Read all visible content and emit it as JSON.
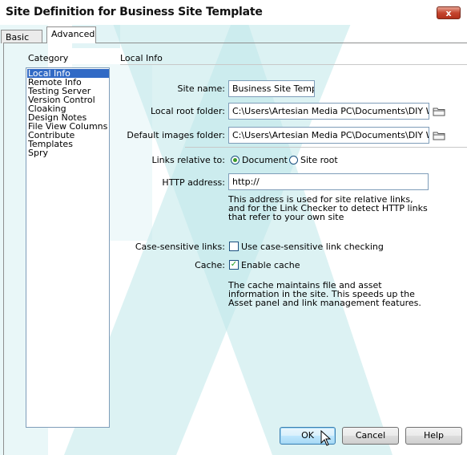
{
  "window": {
    "title": "Site Definition for Business Site Template",
    "close_label": "x"
  },
  "tabs": [
    {
      "label": "Basic"
    },
    {
      "label": "Advanced"
    }
  ],
  "category": {
    "heading": "Category",
    "items": [
      {
        "label": "Local Info",
        "selected": true
      },
      {
        "label": "Remote Info"
      },
      {
        "label": "Testing Server"
      },
      {
        "label": "Version Control"
      },
      {
        "label": "Cloaking"
      },
      {
        "label": "Design Notes"
      },
      {
        "label": "File View Columns"
      },
      {
        "label": "Contribute"
      },
      {
        "label": "Templates"
      },
      {
        "label": "Spry"
      }
    ]
  },
  "section": {
    "heading": "Local Info"
  },
  "fields": {
    "site_name": {
      "label": "Site name:",
      "value": "Business Site Templa"
    },
    "local_root": {
      "label": "Local root folder:",
      "value": "C:\\Users\\Artesian Media PC\\Documents\\DIY Web S"
    },
    "default_images": {
      "label": "Default images folder:",
      "value": "C:\\Users\\Artesian Media PC\\Documents\\DIY Web S"
    },
    "links_relative": {
      "label": "Links relative to:",
      "option_document": "Document",
      "option_site_root": "Site root",
      "selected": "Document"
    },
    "http_address": {
      "label": "HTTP address:",
      "value": "http://",
      "help": "This address is used for site relative links, and for the Link Checker to detect HTTP links that refer to your own site"
    },
    "case_sensitive": {
      "label": "Case-sensitive links:",
      "checkbox_label": "Use case-sensitive link checking",
      "checked": false
    },
    "cache": {
      "label": "Cache:",
      "checkbox_label": "Enable cache",
      "checked": true,
      "help": "The cache maintains file and asset information in the site.  This speeds up the Asset panel and link management features."
    }
  },
  "buttons": {
    "ok": "OK",
    "cancel": "Cancel",
    "help": "Help"
  },
  "colors": {
    "selection": "#316ac5",
    "watermark": "#bfe7ea"
  }
}
